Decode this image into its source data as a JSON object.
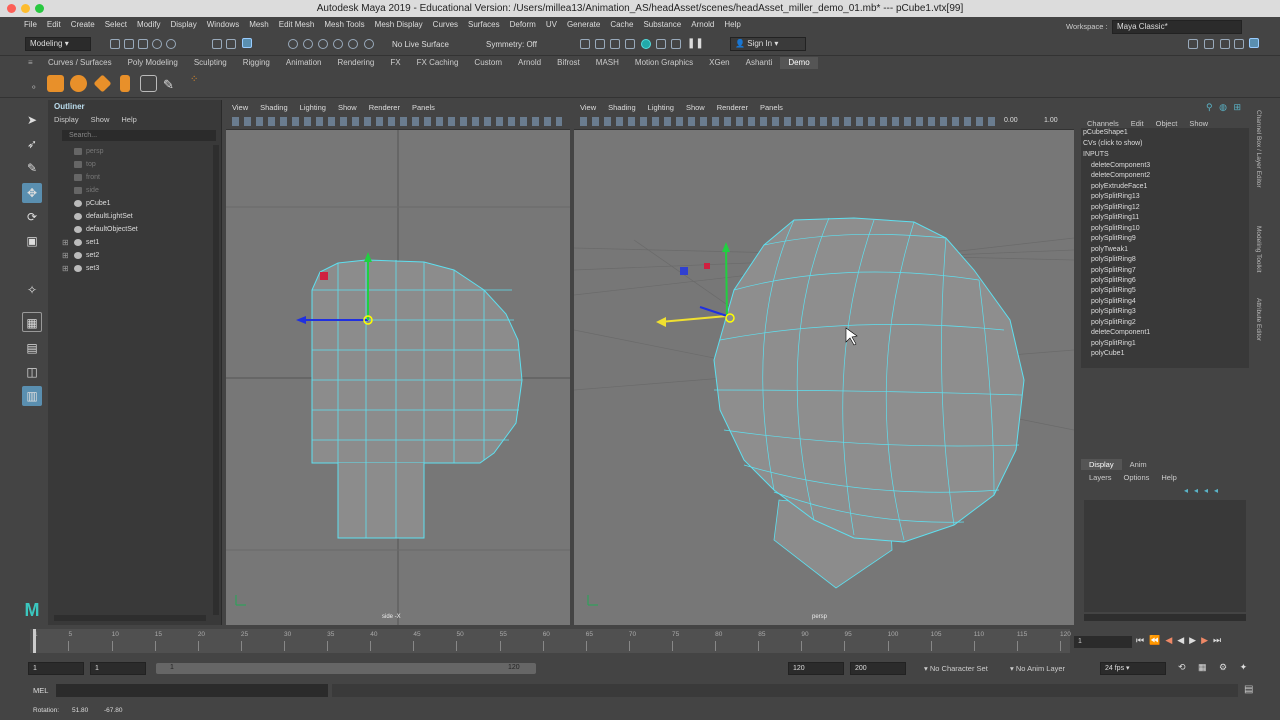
{
  "window": {
    "title": "Autodesk Maya 2019 - Educational Version: /Users/millea13/Animation_AS/headAsset/scenes/headAsset_miller_demo_01.mb*  ---  pCube1.vtx[99]"
  },
  "menubar": [
    "File",
    "Edit",
    "Create",
    "Select",
    "Modify",
    "Display",
    "Windows",
    "Mesh",
    "Edit Mesh",
    "Mesh Tools",
    "Mesh Display",
    "Curves",
    "Surfaces",
    "Deform",
    "UV",
    "Generate",
    "Cache",
    "Substance",
    "Arnold",
    "Help"
  ],
  "statusline": {
    "menuset": "Modeling",
    "live_surface": "No Live Surface",
    "symmetry": "Symmetry: Off",
    "sign_in": "Sign In",
    "workspace_label": "Workspace :",
    "workspace": "Maya Classic*"
  },
  "shelf_tabs": [
    "Curves / Surfaces",
    "Poly Modeling",
    "Sculpting",
    "Rigging",
    "Animation",
    "Rendering",
    "FX",
    "FX Caching",
    "Custom",
    "Arnold",
    "Bifrost",
    "MASH",
    "Motion Graphics",
    "XGen",
    "Ashanti",
    "Demo"
  ],
  "outliner": {
    "title": "Outliner",
    "menu": [
      "Display",
      "Show",
      "Help"
    ],
    "search": "Search...",
    "items": [
      {
        "label": "persp",
        "dim": true,
        "icon": "camera-icon"
      },
      {
        "label": "top",
        "dim": true,
        "icon": "camera-icon"
      },
      {
        "label": "front",
        "dim": true,
        "icon": "camera-icon"
      },
      {
        "label": "side",
        "dim": true,
        "icon": "camera-icon"
      },
      {
        "label": "pCube1",
        "dim": false,
        "icon": "mesh-icon"
      },
      {
        "label": "defaultLightSet",
        "dim": false,
        "icon": "set-icon"
      },
      {
        "label": "defaultObjectSet",
        "dim": false,
        "icon": "set-icon"
      },
      {
        "label": "set1",
        "dim": false,
        "icon": "set-icon"
      },
      {
        "label": "set2",
        "dim": false,
        "icon": "set-icon"
      },
      {
        "label": "set3",
        "dim": false,
        "icon": "set-icon"
      }
    ]
  },
  "viewports": {
    "menu": [
      "View",
      "Shading",
      "Lighting",
      "Show",
      "Renderer",
      "Panels"
    ],
    "left_label": "side -X",
    "right_label": "persp",
    "exposure": "0.00",
    "gamma": "1.00"
  },
  "channelbox": {
    "menu": [
      "Channels",
      "Edit",
      "Object",
      "Show"
    ],
    "shape": "pCubeShape1",
    "cvs": "CVs (click to show)",
    "inputs_label": "INPUTS",
    "inputs": [
      "deleteComponent3",
      "deleteComponent2",
      "polyExtrudeFace1",
      "polySplitRing13",
      "polySplitRing12",
      "polySplitRing11",
      "polySplitRing10",
      "polySplitRing9",
      "polyTweak1",
      "polySplitRing8",
      "polySplitRing7",
      "polySplitRing6",
      "polySplitRing5",
      "polySplitRing4",
      "polySplitRing3",
      "polySplitRing2",
      "deleteComponent1",
      "polySplitRing1",
      "polyCube1"
    ],
    "side_tabs": [
      "Channel Box / Layer Editor",
      "Modeling Toolkit",
      "Attribute Editor"
    ]
  },
  "layer_editor": {
    "tabs": [
      "Display",
      "Anim"
    ],
    "menu": [
      "Layers",
      "Options",
      "Help"
    ]
  },
  "timeline": {
    "ticks": [
      "1",
      "5",
      "10",
      "15",
      "20",
      "25",
      "30",
      "35",
      "40",
      "45",
      "50",
      "55",
      "60",
      "65",
      "70",
      "75",
      "80",
      "85",
      "90",
      "95",
      "100",
      "105",
      "110",
      "115",
      "120"
    ],
    "current_frame": "1"
  },
  "range": {
    "start": "1",
    "anim_start": "1",
    "range_start": "1",
    "range_end": "120",
    "anim_end": "120",
    "end": "200",
    "char_set": "No Character Set",
    "anim_layer": "No Anim Layer",
    "fps": "24 fps"
  },
  "command": {
    "label": "MEL"
  },
  "help": {
    "label": "Rotation:",
    "x": "51.80",
    "y": "-67.80"
  },
  "colors": {
    "wire": "#5ee0f0",
    "accent": "#5ab4c8",
    "mesh": "#8c8c8c"
  }
}
